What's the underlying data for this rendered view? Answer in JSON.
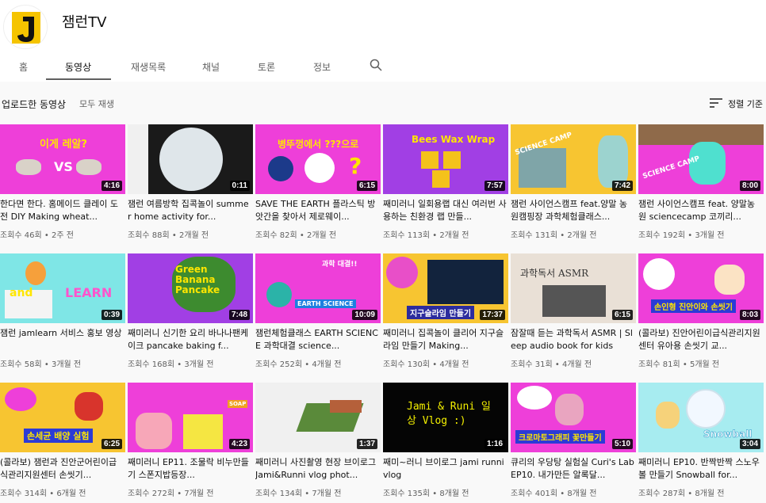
{
  "channel": {
    "name": "잼런TV",
    "logo_letter": "J"
  },
  "tabs": [
    {
      "label": "홈"
    },
    {
      "label": "동영상"
    },
    {
      "label": "재생목록"
    },
    {
      "label": "채널"
    },
    {
      "label": "토론"
    },
    {
      "label": "정보"
    }
  ],
  "section": {
    "title": "업로드한 동영상",
    "play_all": "모두 재생",
    "sort_label": "정렬 기준"
  },
  "videos": [
    {
      "title": "한다면 한다. 홈메이드 클레이 도전 DIY Making wheat...",
      "meta": "조회수 46회 • 2주 전",
      "duration": "4:16",
      "thumb_text": "이게 레알?",
      "thumb_text2": "VS"
    },
    {
      "title": "잼런 여름방학 집콕놀이 summer home activity for...",
      "meta": "조회수 88회 • 2개월 전",
      "duration": "0:11",
      "thumb_text": "",
      "thumb_text2": ""
    },
    {
      "title": "SAVE THE EARTH 플라스틱 방앗간을 찾아서 제로웨이...",
      "meta": "조회수 82회 • 2개월 전",
      "duration": "6:15",
      "thumb_text": "병뚜껑에서 ???으로",
      "thumb_text2": "?"
    },
    {
      "title": "째미러니 일회용랩 대신 여러번 사용하는 친환경 랩 만들...",
      "meta": "조회수 113회 • 2개월 전",
      "duration": "7:57",
      "thumb_text": "Bees Wax Wrap",
      "thumb_text2": ""
    },
    {
      "title": "잼런 사이언스캠프 feat.양말 농원캠핑장 과학체험클래스...",
      "meta": "조회수 131회 • 2개월 전",
      "duration": "7:42",
      "thumb_text": "SCIENCE CAMP",
      "thumb_text2": ""
    },
    {
      "title": "잼런 사이언스캠프 feat. 양말농원 sciencecamp 코끼리...",
      "meta": "조회수 192회 • 3개월 전",
      "duration": "8:00",
      "thumb_text": "SCIENCE CAMP",
      "thumb_text2": ""
    },
    {
      "title": "잼런 jamlearn 서비스 홍보 영상",
      "meta": "조회수 58회 • 3개월 전",
      "duration": "0:39",
      "thumb_text": "and",
      "thumb_text2": "LEARN"
    },
    {
      "title": "째미러니 신기한 요리 바나나팬케이크 pancake baking f...",
      "meta": "조회수 168회 • 3개월 전",
      "duration": "7:48",
      "thumb_text": "Green Banana Pancake",
      "thumb_text2": ""
    },
    {
      "title": "잼런체험클래스 EARTH SCIENCE 과학대결 science...",
      "meta": "조회수 252회 • 4개월 전",
      "duration": "10:09",
      "thumb_text": "EARTH SCIENCE",
      "thumb_text2": "과학 대결!!"
    },
    {
      "title": "째미러니 집콕놀이 클리어 지구슬라임 만들기 Making...",
      "meta": "조회수 130회 • 4개월 전",
      "duration": "17:37",
      "thumb_text": "지구슬라임 만들기",
      "thumb_text2": ""
    },
    {
      "title": "잠잘때 듣는 과학독서 ASMR | Sleep audio book for kids",
      "meta": "조회수 31회 • 4개월 전",
      "duration": "6:15",
      "thumb_text": "과학독서 ASMR",
      "thumb_text2": ""
    },
    {
      "title": "(콜라보) 진안어린이급식관리지원센터 유아용 손씻기 교...",
      "meta": "조회수 81회 • 5개월 전",
      "duration": "8:03",
      "thumb_text": "손인형 진안이와 손씻기",
      "thumb_text2": ""
    },
    {
      "title": "(콜라보) 잼런과 진안군어린이급식관리지원센터 손씻기...",
      "meta": "조회수 314회 • 6개월 전",
      "duration": "6:25",
      "thumb_text": "손세균 배양 실험",
      "thumb_text2": ""
    },
    {
      "title": "째미러니 EP11. 조물락 비누만들기 스폰지밥등장...",
      "meta": "조회수 272회 • 7개월 전",
      "duration": "4:23",
      "thumb_text": "SOAP",
      "thumb_text2": ""
    },
    {
      "title": "째미러니 사진촬영 현장 브이로그 Jami&Runni vlog phot...",
      "meta": "조회수 134회 • 7개월 전",
      "duration": "1:37",
      "thumb_text": "",
      "thumb_text2": ""
    },
    {
      "title": "째미~러니 브이로그 jami runni vlog",
      "meta": "조회수 135회 • 8개월 전",
      "duration": "1:16",
      "thumb_text": "Jami & Runi 일상 Vlog :)",
      "thumb_text2": ""
    },
    {
      "title": "큐리의 우당탕 실험실 Curi's Lab EP10. 내가만든 알록달...",
      "meta": "조회수 401회 • 8개월 전",
      "duration": "5:10",
      "thumb_text": "크로마토그래피 꽃만들기",
      "thumb_text2": ""
    },
    {
      "title": "째미러니 EP10. 반짝반짝 스노우볼 만들기 Snowball for...",
      "meta": "조회수 287회 • 8개월 전",
      "duration": "3:04",
      "thumb_text": "Snowball",
      "thumb_text2": ""
    }
  ],
  "colors": {
    "accent": "#606060",
    "brand_yellow": "#f5c400",
    "thumb_pink": "#f43ad6",
    "thumb_purple": "#9b3fe0"
  }
}
